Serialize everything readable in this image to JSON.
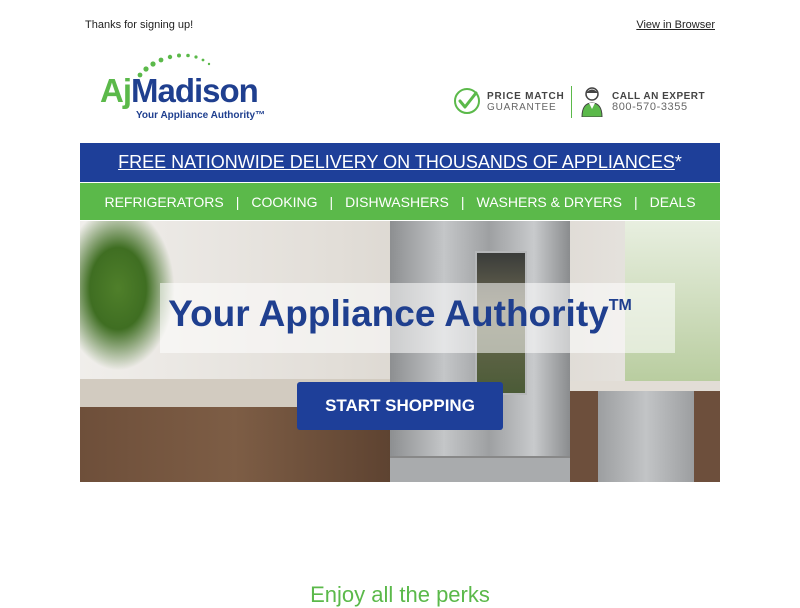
{
  "preheader": {
    "thanks": "Thanks for signing up!",
    "view_in_browser": "View in Browser"
  },
  "logo": {
    "brand_aj": "Aj",
    "brand_madison": "Madison",
    "tagline": "Your Appliance Authority™"
  },
  "header_badges": {
    "price_match_title": "PRICE MATCH",
    "price_match_sub": "GUARANTEE",
    "expert_title": "CALL AN EXPERT",
    "expert_phone": "800-570-3355"
  },
  "shipping_banner": {
    "text": "FREE NATIONWIDE DELIVERY ON THOUSANDS OF APPLIANCES",
    "suffix": "*"
  },
  "nav": {
    "items": [
      "REFRIGERATORS",
      "COOKING",
      "DISHWASHERS",
      "WASHERS & DRYERS",
      "DEALS"
    ],
    "separator": "|"
  },
  "hero": {
    "heading": "Your Appliance Authority",
    "trademark": "TM",
    "cta_label": "START SHOPPING"
  },
  "perks": {
    "heading": "Enjoy all the perks"
  },
  "colors": {
    "brand_blue": "#1e3f99",
    "brand_green": "#5bb94a"
  },
  "icons": [
    "check-circle-icon",
    "expert-agent-icon",
    "logo-dots-arc"
  ]
}
